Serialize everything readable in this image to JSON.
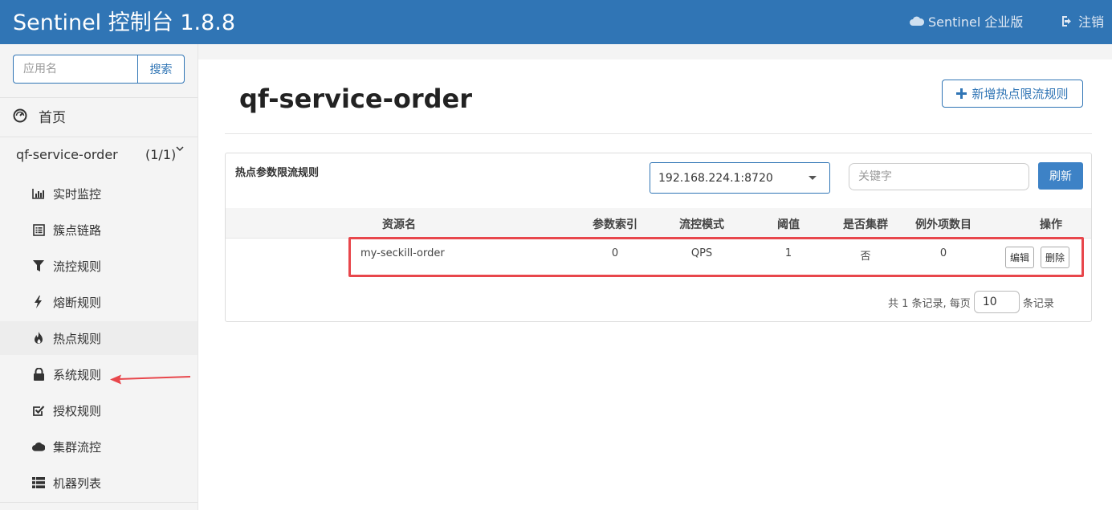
{
  "header": {
    "title": "Sentinel 控制台 1.8.8",
    "enterprise_label": "Sentinel 企业版",
    "logout_label": "注销"
  },
  "sidebar": {
    "search_placeholder": "应用名",
    "search_button": "搜索",
    "home_label": "首页",
    "app": {
      "name": "qf-service-order",
      "count": "(1/1)"
    },
    "items": [
      {
        "label": "实时监控",
        "icon": "bar-chart-icon"
      },
      {
        "label": "簇点链路",
        "icon": "list-alt-icon"
      },
      {
        "label": "流控规则",
        "icon": "filter-icon"
      },
      {
        "label": "熔断规则",
        "icon": "flash-icon"
      },
      {
        "label": "热点规则",
        "icon": "fire-icon"
      },
      {
        "label": "系统规则",
        "icon": "lock-icon"
      },
      {
        "label": "授权规则",
        "icon": "check-square-icon"
      },
      {
        "label": "集群流控",
        "icon": "cloud-icon"
      },
      {
        "label": "机器列表",
        "icon": "th-list-icon"
      }
    ]
  },
  "main": {
    "title": "qf-service-order",
    "add_button": "新增热点限流规则"
  },
  "panel": {
    "title": "热点参数限流规则",
    "machine_select": "192.168.224.1:8720",
    "keyword_placeholder": "关键字",
    "refresh_button": "刷新",
    "columns": [
      "资源名",
      "参数索引",
      "流控模式",
      "阈值",
      "是否集群",
      "例外项数目",
      "操作"
    ],
    "rows": [
      {
        "resource": "my-seckill-order",
        "param_index": "0",
        "mode": "QPS",
        "threshold": "1",
        "cluster": "否",
        "exceptions": "0",
        "edit": "编辑",
        "delete": "删除"
      }
    ],
    "pager": {
      "prefix": "共 1 条记录, 每页",
      "page_size": "10",
      "suffix": "条记录"
    }
  },
  "colors": {
    "primary": "#3075b5",
    "highlight": "#e8474c"
  }
}
